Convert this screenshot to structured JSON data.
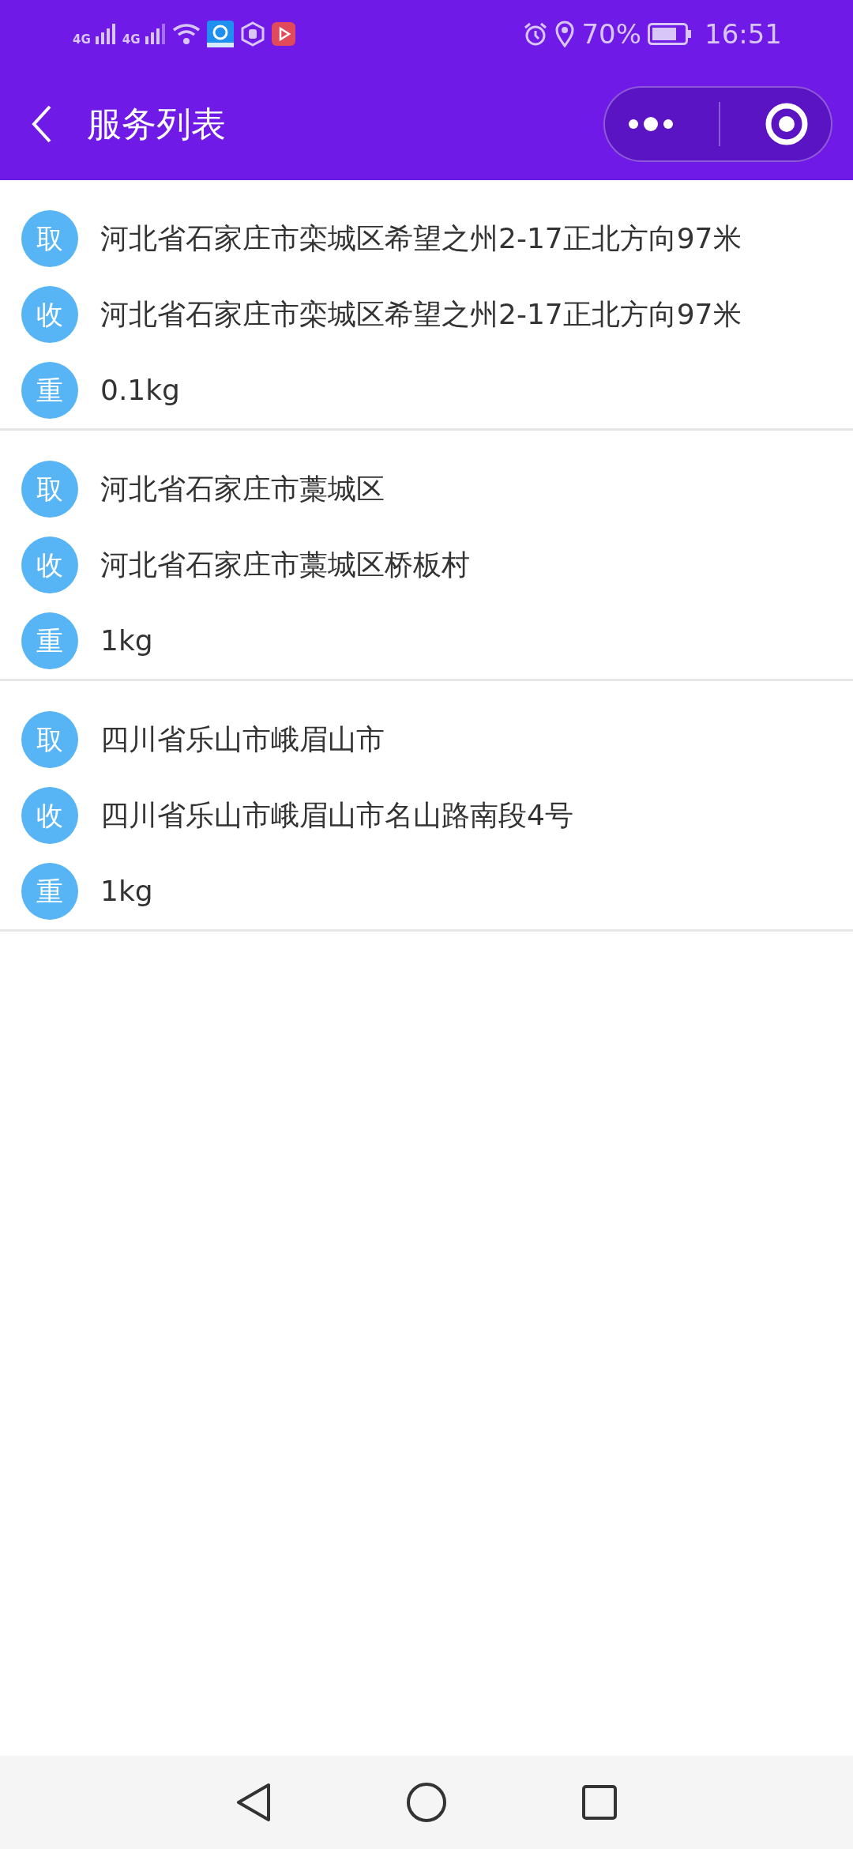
{
  "status_bar": {
    "network_labels": [
      "4G",
      "4G"
    ],
    "battery_percent": "70%",
    "time": "16:51"
  },
  "header": {
    "title": "服务列表"
  },
  "orders": [
    {
      "fields": [
        {
          "badge": "取",
          "text": "河北省石家庄市栾城区希望之州2-17正北方向97米"
        },
        {
          "badge": "收",
          "text": "河北省石家庄市栾城区希望之州2-17正北方向97米"
        },
        {
          "badge": "重",
          "text": "0.1kg"
        }
      ]
    },
    {
      "fields": [
        {
          "badge": "取",
          "text": "河北省石家庄市藁城区"
        },
        {
          "badge": "收",
          "text": "河北省石家庄市藁城区桥板村"
        },
        {
          "badge": "重",
          "text": "1kg"
        }
      ]
    },
    {
      "fields": [
        {
          "badge": "取",
          "text": "四川省乐山市峨眉山市"
        },
        {
          "badge": "收",
          "text": "四川省乐山市峨眉山市名山路南段4号"
        },
        {
          "badge": "重",
          "text": "1kg"
        }
      ]
    }
  ]
}
